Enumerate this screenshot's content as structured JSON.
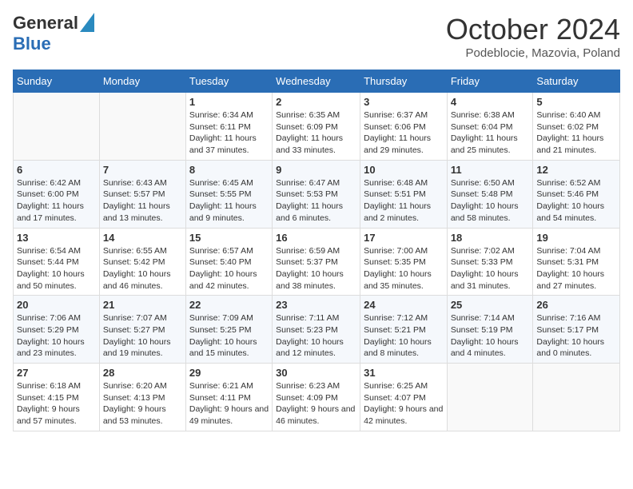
{
  "header": {
    "logo_line1": "General",
    "logo_line2": "Blue",
    "month": "October 2024",
    "location": "Podeblocie, Mazovia, Poland"
  },
  "days_of_week": [
    "Sunday",
    "Monday",
    "Tuesday",
    "Wednesday",
    "Thursday",
    "Friday",
    "Saturday"
  ],
  "weeks": [
    [
      {
        "day": "",
        "info": ""
      },
      {
        "day": "",
        "info": ""
      },
      {
        "day": "1",
        "info": "Sunrise: 6:34 AM\nSunset: 6:11 PM\nDaylight: 11 hours and 37 minutes."
      },
      {
        "day": "2",
        "info": "Sunrise: 6:35 AM\nSunset: 6:09 PM\nDaylight: 11 hours and 33 minutes."
      },
      {
        "day": "3",
        "info": "Sunrise: 6:37 AM\nSunset: 6:06 PM\nDaylight: 11 hours and 29 minutes."
      },
      {
        "day": "4",
        "info": "Sunrise: 6:38 AM\nSunset: 6:04 PM\nDaylight: 11 hours and 25 minutes."
      },
      {
        "day": "5",
        "info": "Sunrise: 6:40 AM\nSunset: 6:02 PM\nDaylight: 11 hours and 21 minutes."
      }
    ],
    [
      {
        "day": "6",
        "info": "Sunrise: 6:42 AM\nSunset: 6:00 PM\nDaylight: 11 hours and 17 minutes."
      },
      {
        "day": "7",
        "info": "Sunrise: 6:43 AM\nSunset: 5:57 PM\nDaylight: 11 hours and 13 minutes."
      },
      {
        "day": "8",
        "info": "Sunrise: 6:45 AM\nSunset: 5:55 PM\nDaylight: 11 hours and 9 minutes."
      },
      {
        "day": "9",
        "info": "Sunrise: 6:47 AM\nSunset: 5:53 PM\nDaylight: 11 hours and 6 minutes."
      },
      {
        "day": "10",
        "info": "Sunrise: 6:48 AM\nSunset: 5:51 PM\nDaylight: 11 hours and 2 minutes."
      },
      {
        "day": "11",
        "info": "Sunrise: 6:50 AM\nSunset: 5:48 PM\nDaylight: 10 hours and 58 minutes."
      },
      {
        "day": "12",
        "info": "Sunrise: 6:52 AM\nSunset: 5:46 PM\nDaylight: 10 hours and 54 minutes."
      }
    ],
    [
      {
        "day": "13",
        "info": "Sunrise: 6:54 AM\nSunset: 5:44 PM\nDaylight: 10 hours and 50 minutes."
      },
      {
        "day": "14",
        "info": "Sunrise: 6:55 AM\nSunset: 5:42 PM\nDaylight: 10 hours and 46 minutes."
      },
      {
        "day": "15",
        "info": "Sunrise: 6:57 AM\nSunset: 5:40 PM\nDaylight: 10 hours and 42 minutes."
      },
      {
        "day": "16",
        "info": "Sunrise: 6:59 AM\nSunset: 5:37 PM\nDaylight: 10 hours and 38 minutes."
      },
      {
        "day": "17",
        "info": "Sunrise: 7:00 AM\nSunset: 5:35 PM\nDaylight: 10 hours and 35 minutes."
      },
      {
        "day": "18",
        "info": "Sunrise: 7:02 AM\nSunset: 5:33 PM\nDaylight: 10 hours and 31 minutes."
      },
      {
        "day": "19",
        "info": "Sunrise: 7:04 AM\nSunset: 5:31 PM\nDaylight: 10 hours and 27 minutes."
      }
    ],
    [
      {
        "day": "20",
        "info": "Sunrise: 7:06 AM\nSunset: 5:29 PM\nDaylight: 10 hours and 23 minutes."
      },
      {
        "day": "21",
        "info": "Sunrise: 7:07 AM\nSunset: 5:27 PM\nDaylight: 10 hours and 19 minutes."
      },
      {
        "day": "22",
        "info": "Sunrise: 7:09 AM\nSunset: 5:25 PM\nDaylight: 10 hours and 15 minutes."
      },
      {
        "day": "23",
        "info": "Sunrise: 7:11 AM\nSunset: 5:23 PM\nDaylight: 10 hours and 12 minutes."
      },
      {
        "day": "24",
        "info": "Sunrise: 7:12 AM\nSunset: 5:21 PM\nDaylight: 10 hours and 8 minutes."
      },
      {
        "day": "25",
        "info": "Sunrise: 7:14 AM\nSunset: 5:19 PM\nDaylight: 10 hours and 4 minutes."
      },
      {
        "day": "26",
        "info": "Sunrise: 7:16 AM\nSunset: 5:17 PM\nDaylight: 10 hours and 0 minutes."
      }
    ],
    [
      {
        "day": "27",
        "info": "Sunrise: 6:18 AM\nSunset: 4:15 PM\nDaylight: 9 hours and 57 minutes."
      },
      {
        "day": "28",
        "info": "Sunrise: 6:20 AM\nSunset: 4:13 PM\nDaylight: 9 hours and 53 minutes."
      },
      {
        "day": "29",
        "info": "Sunrise: 6:21 AM\nSunset: 4:11 PM\nDaylight: 9 hours and 49 minutes."
      },
      {
        "day": "30",
        "info": "Sunrise: 6:23 AM\nSunset: 4:09 PM\nDaylight: 9 hours and 46 minutes."
      },
      {
        "day": "31",
        "info": "Sunrise: 6:25 AM\nSunset: 4:07 PM\nDaylight: 9 hours and 42 minutes."
      },
      {
        "day": "",
        "info": ""
      },
      {
        "day": "",
        "info": ""
      }
    ]
  ]
}
